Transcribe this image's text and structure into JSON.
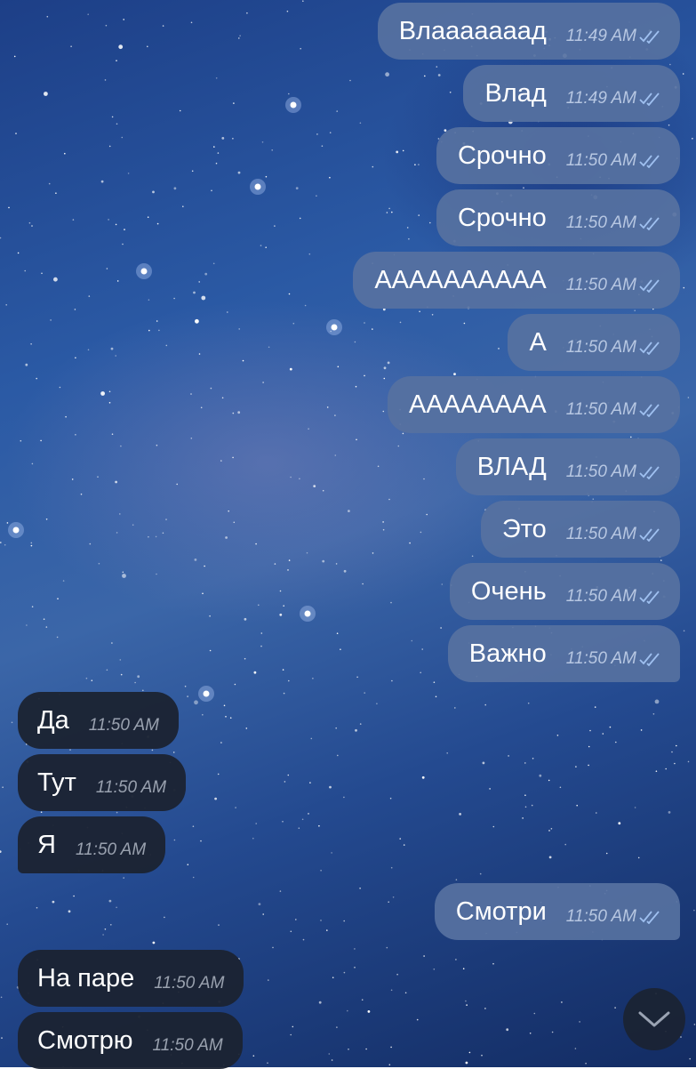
{
  "chat": {
    "outgoing_1": {
      "text": "Влааааааад",
      "time": "11:49 AM"
    },
    "outgoing_2": {
      "text": "Влад",
      "time": "11:49 AM"
    },
    "outgoing_3": {
      "text": "Срочно",
      "time": "11:50 AM"
    },
    "outgoing_4": {
      "text": "Срочно",
      "time": "11:50 AM"
    },
    "outgoing_5": {
      "text": "АААААААААА",
      "time": "11:50 AM"
    },
    "outgoing_6": {
      "text": "А",
      "time": "11:50 AM"
    },
    "outgoing_7": {
      "text": "АААААААА",
      "time": "11:50 AM"
    },
    "outgoing_8": {
      "text": "ВЛАД",
      "time": "11:50 AM"
    },
    "outgoing_9": {
      "text": "Это",
      "time": "11:50 AM"
    },
    "outgoing_10": {
      "text": "Очень",
      "time": "11:50 AM"
    },
    "outgoing_11": {
      "text": "Важно",
      "time": "11:50 AM"
    },
    "incoming_1": {
      "text": "Да",
      "time": "11:50 AM"
    },
    "incoming_2": {
      "text": "Тут",
      "time": "11:50 AM"
    },
    "incoming_3": {
      "text": "Я",
      "time": "11:50 AM"
    },
    "outgoing_12": {
      "text": "Смотри",
      "time": "11:50 AM"
    },
    "incoming_4": {
      "text": "На паре",
      "time": "11:50 AM"
    },
    "incoming_5": {
      "text": "Смотрю",
      "time": "11:50 AM"
    }
  },
  "icons": {
    "read_receipt": "double-check-icon",
    "scroll_down": "chevron-down-icon"
  },
  "colors": {
    "outgoing_bubble": "#5671a0",
    "incoming_bubble": "#1b2332",
    "read_check": "#9fc0f0"
  }
}
